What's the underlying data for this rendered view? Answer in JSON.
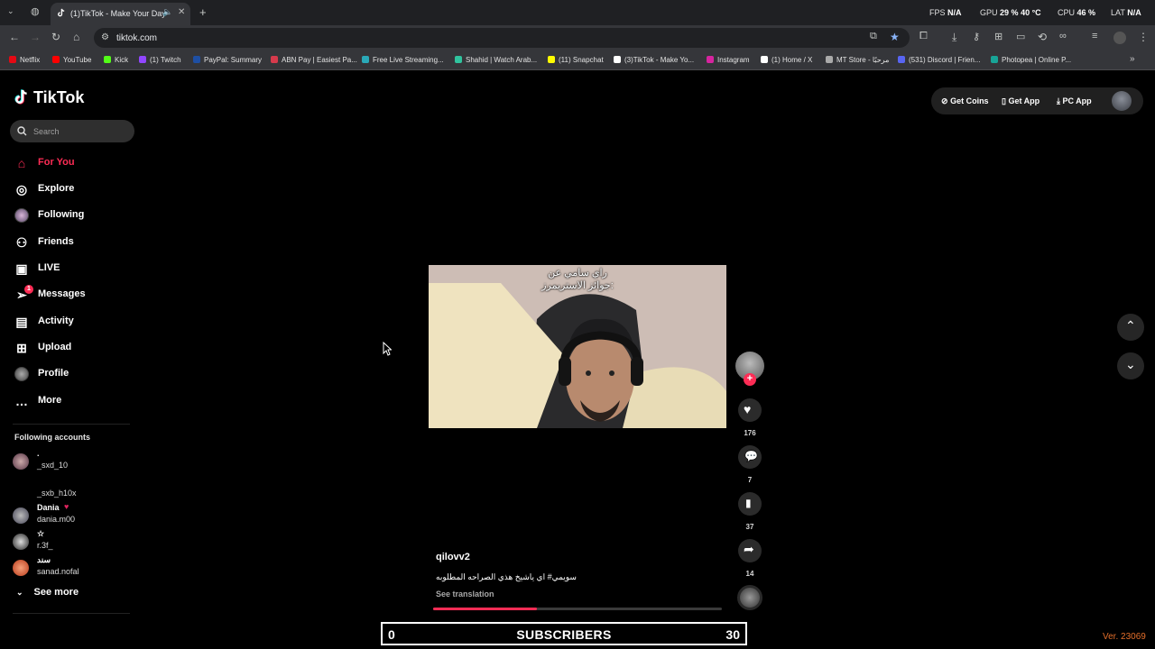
{
  "browser": {
    "tab_title": "(1)TikTok - Make Your Day",
    "url": "tiktok.com",
    "stats": {
      "fps_label": "FPS",
      "fps": "N/A",
      "gpu_label": "GPU",
      "gpu": "29 %",
      "gpu_temp": "40 °C",
      "cpu_label": "CPU",
      "cpu": "46 %",
      "lat_label": "LAT",
      "lat": "N/A"
    },
    "bookmarks": [
      {
        "label": "Netflix",
        "color": "#e50914"
      },
      {
        "label": "YouTube",
        "color": "#ff0000"
      },
      {
        "label": "Kick",
        "color": "#53fc18"
      },
      {
        "label": "(1) Twitch",
        "color": "#9146ff"
      },
      {
        "label": "PayPal: Summary",
        "color": "#1e4fa3"
      },
      {
        "label": "ABN Pay | Easiest Pa...",
        "color": "#d63a4c"
      },
      {
        "label": "Free Live Streaming...",
        "color": "#2aa9b8"
      },
      {
        "label": "Shahid | Watch Arab...",
        "color": "#30c39e"
      },
      {
        "label": "(11) Snapchat",
        "color": "#fffc00"
      },
      {
        "label": "(3)TikTok - Make Yo...",
        "color": "#ffffff"
      },
      {
        "label": "Instagram",
        "color": "#d6249f"
      },
      {
        "label": "(1) Home / X",
        "color": "#ffffff"
      },
      {
        "label": "MT Store - مرحبًا",
        "color": "#aaaaaa"
      },
      {
        "label": "(531) Discord | Frien...",
        "color": "#5865f2"
      },
      {
        "label": "Photopea | Online P...",
        "color": "#18a497"
      }
    ]
  },
  "sidebar": {
    "logo": "TikTok",
    "search_placeholder": "Search",
    "nav": [
      {
        "label": "For You",
        "icon": "home-icon",
        "active": true
      },
      {
        "label": "Explore",
        "icon": "compass-icon"
      },
      {
        "label": "Following",
        "icon": "following-avatar-icon"
      },
      {
        "label": "Friends",
        "icon": "friends-icon"
      },
      {
        "label": "LIVE",
        "icon": "live-tv-icon"
      },
      {
        "label": "Messages",
        "icon": "send-icon",
        "badge": "1"
      },
      {
        "label": "Activity",
        "icon": "activity-icon"
      },
      {
        "label": "Upload",
        "icon": "upload-icon"
      },
      {
        "label": "Profile",
        "icon": "profile-avatar-icon"
      },
      {
        "label": "More",
        "icon": "more-dots-icon"
      }
    ],
    "following_header": "Following accounts",
    "accounts": [
      {
        "name": ".",
        "handle": "_sxd_10"
      },
      {
        "name": "",
        "handle": "_sxb_h10x"
      },
      {
        "name": "Dania",
        "handle": "dania.m00"
      },
      {
        "name": "☆",
        "handle": "r.3f_"
      },
      {
        "name": "سند",
        "handle": "sanad.nofal"
      }
    ],
    "see_more": "See more"
  },
  "header": {
    "get_coins": "Get Coins",
    "get_app": "Get App",
    "pc_app": "PC App"
  },
  "video": {
    "caption_overlay_line1": "راي سامي عن",
    "caption_overlay_line2": "جوائز الاستريمرز:",
    "author": "qilovv2",
    "description": "سويمي# اي ياشيخ هذي الصراحه المطلوبه",
    "see_translation": "See translation",
    "progress": 0.36,
    "likes": "176",
    "comments": "7",
    "saves": "37",
    "shares": "14"
  },
  "footer": {
    "left_count": "0",
    "label": "SUBSCRIBERS",
    "right_count": "30",
    "version": "Ver. 23069"
  },
  "colors": {
    "accent": "#fe2c55",
    "version": "#e36e2a"
  }
}
